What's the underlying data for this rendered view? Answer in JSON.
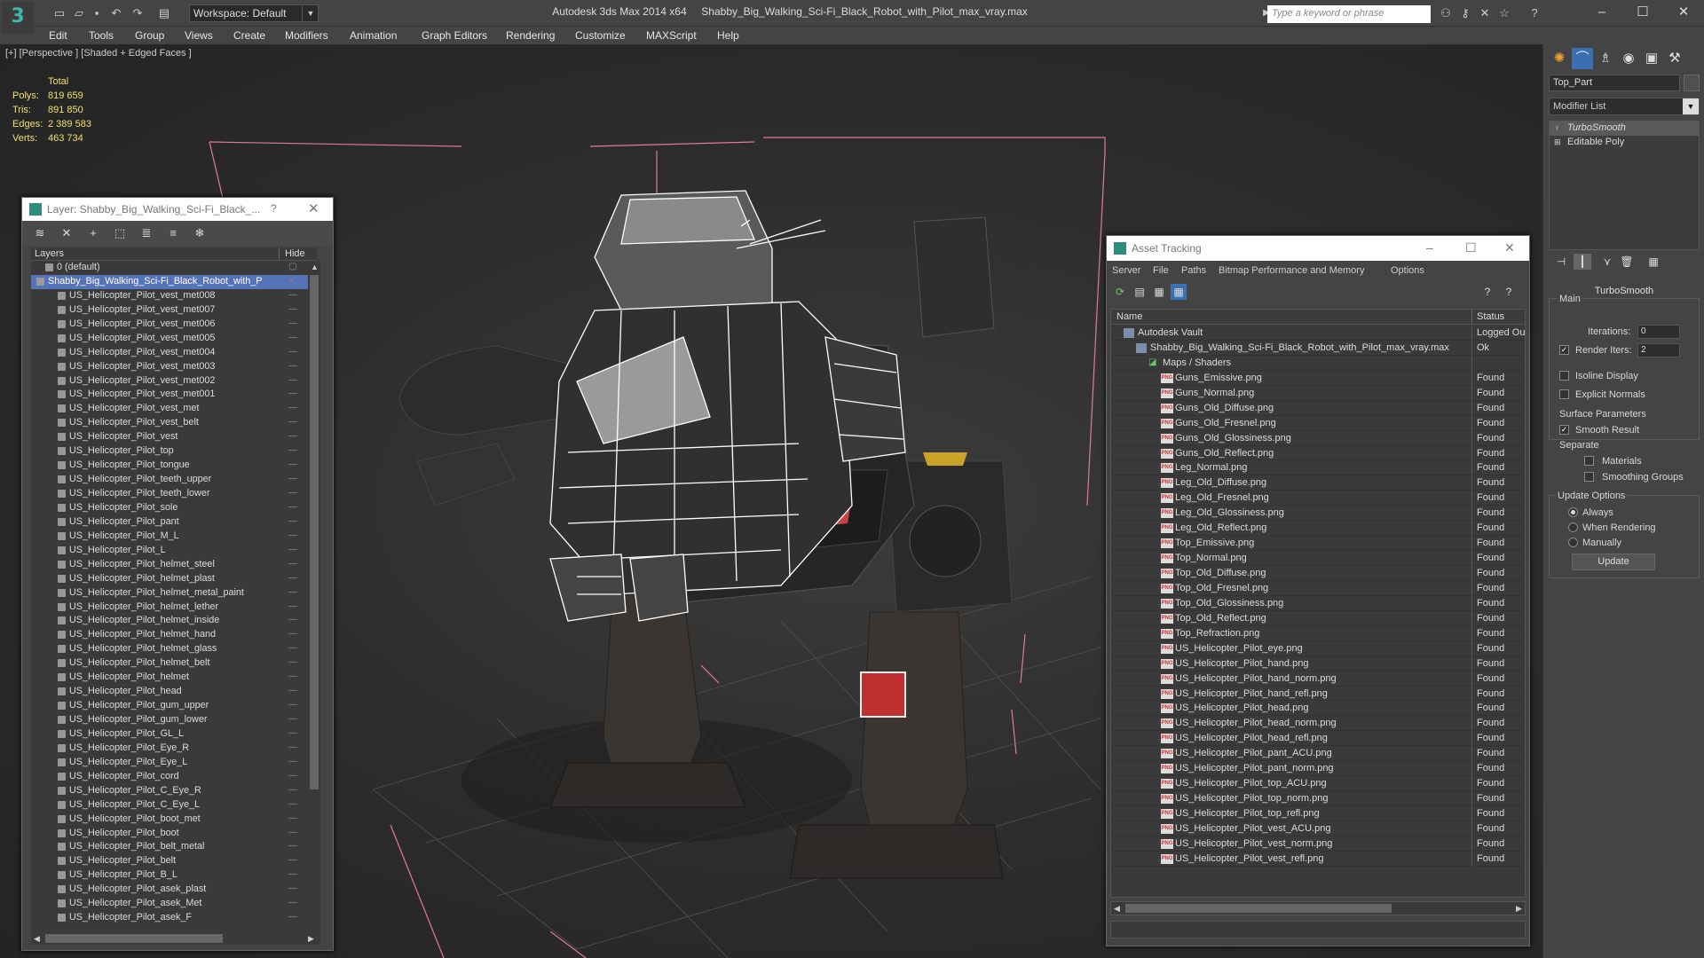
{
  "titlebar": {
    "app": "Autodesk 3ds Max  2014 x64",
    "file": "Shabby_Big_Walking_Sci-Fi_Black_Robot_with_Pilot_max_vray.max",
    "workspace": "Workspace: Default",
    "search_placeholder": "Type a keyword or phrase"
  },
  "menu": [
    "Edit",
    "Tools",
    "Group",
    "Views",
    "Create",
    "Modifiers",
    "Animation",
    "Graph Editors",
    "Rendering",
    "Customize",
    "MAXScript",
    "Help"
  ],
  "viewport": {
    "label": "[+] [Perspective ] [Shaded + Edged Faces ]",
    "stats_header": "Total",
    "stats": [
      {
        "key": "Polys:",
        "value": "819 659"
      },
      {
        "key": "Tris:",
        "value": "891 850"
      },
      {
        "key": "Edges:",
        "value": "2 389 583"
      },
      {
        "key": "Verts:",
        "value": "463 734"
      }
    ]
  },
  "layer_dialog": {
    "title": "Layer: Shabby_Big_Walking_Sci-Fi_Black_...",
    "help": "?",
    "col_layers": "Layers",
    "col_hide": "Hide",
    "rows": [
      {
        "name": "0 (default)",
        "level": 1
      },
      {
        "name": "Shabby_Big_Walking_Sci-Fi_Black_Robot_with_P",
        "level": 0,
        "selected": true
      },
      {
        "name": "US_Helicopter_Pilot_vest_met008",
        "level": 2
      },
      {
        "name": "US_Helicopter_Pilot_vest_met007",
        "level": 2
      },
      {
        "name": "US_Helicopter_Pilot_vest_met006",
        "level": 2
      },
      {
        "name": "US_Helicopter_Pilot_vest_met005",
        "level": 2
      },
      {
        "name": "US_Helicopter_Pilot_vest_met004",
        "level": 2
      },
      {
        "name": "US_Helicopter_Pilot_vest_met003",
        "level": 2
      },
      {
        "name": "US_Helicopter_Pilot_vest_met002",
        "level": 2
      },
      {
        "name": "US_Helicopter_Pilot_vest_met001",
        "level": 2
      },
      {
        "name": "US_Helicopter_Pilot_vest_met",
        "level": 2
      },
      {
        "name": "US_Helicopter_Pilot_vest_belt",
        "level": 2
      },
      {
        "name": "US_Helicopter_Pilot_vest",
        "level": 2
      },
      {
        "name": "US_Helicopter_Pilot_top",
        "level": 2
      },
      {
        "name": "US_Helicopter_Pilot_tongue",
        "level": 2
      },
      {
        "name": "US_Helicopter_Pilot_teeth_upper",
        "level": 2
      },
      {
        "name": "US_Helicopter_Pilot_teeth_lower",
        "level": 2
      },
      {
        "name": "US_Helicopter_Pilot_sole",
        "level": 2
      },
      {
        "name": "US_Helicopter_Pilot_pant",
        "level": 2
      },
      {
        "name": "US_Helicopter_Pilot_M_L",
        "level": 2
      },
      {
        "name": "US_Helicopter_Pilot_L",
        "level": 2
      },
      {
        "name": "US_Helicopter_Pilot_helmet_steel",
        "level": 2
      },
      {
        "name": "US_Helicopter_Pilot_helmet_plast",
        "level": 2
      },
      {
        "name": "US_Helicopter_Pilot_helmet_metal_paint",
        "level": 2
      },
      {
        "name": "US_Helicopter_Pilot_helmet_lether",
        "level": 2
      },
      {
        "name": "US_Helicopter_Pilot_helmet_inside",
        "level": 2
      },
      {
        "name": "US_Helicopter_Pilot_helmet_hand",
        "level": 2
      },
      {
        "name": "US_Helicopter_Pilot_helmet_glass",
        "level": 2
      },
      {
        "name": "US_Helicopter_Pilot_helmet_belt",
        "level": 2
      },
      {
        "name": "US_Helicopter_Pilot_helmet",
        "level": 2
      },
      {
        "name": "US_Helicopter_Pilot_head",
        "level": 2
      },
      {
        "name": "US_Helicopter_Pilot_gum_upper",
        "level": 2
      },
      {
        "name": "US_Helicopter_Pilot_gum_lower",
        "level": 2
      },
      {
        "name": "US_Helicopter_Pilot_GL_L",
        "level": 2
      },
      {
        "name": "US_Helicopter_Pilot_Eye_R",
        "level": 2
      },
      {
        "name": "US_Helicopter_Pilot_Eye_L",
        "level": 2
      },
      {
        "name": "US_Helicopter_Pilot_cord",
        "level": 2
      },
      {
        "name": "US_Helicopter_Pilot_C_Eye_R",
        "level": 2
      },
      {
        "name": "US_Helicopter_Pilot_C_Eye_L",
        "level": 2
      },
      {
        "name": "US_Helicopter_Pilot_boot_met",
        "level": 2
      },
      {
        "name": "US_Helicopter_Pilot_boot",
        "level": 2
      },
      {
        "name": "US_Helicopter_Pilot_belt_metal",
        "level": 2
      },
      {
        "name": "US_Helicopter_Pilot_belt",
        "level": 2
      },
      {
        "name": "US_Helicopter_Pilot_B_L",
        "level": 2
      },
      {
        "name": "US_Helicopter_Pilot_asek_plast",
        "level": 2
      },
      {
        "name": "US_Helicopter_Pilot_asek_Met",
        "level": 2
      },
      {
        "name": "US_Helicopter_Pilot_asek_F",
        "level": 2
      }
    ]
  },
  "asset_dialog": {
    "title": "Asset Tracking",
    "menu": [
      "Server",
      "File",
      "Paths",
      "Bitmap Performance and Memory",
      "Options"
    ],
    "col_name": "Name",
    "col_status": "Status",
    "rows": [
      {
        "name": "Autodesk Vault",
        "status": "Logged Ou",
        "type": "vault",
        "level": 0
      },
      {
        "name": "Shabby_Big_Walking_Sci-Fi_Black_Robot_with_Pilot_max_vray.max",
        "status": "Ok",
        "type": "max",
        "level": 1
      },
      {
        "name": "Maps / Shaders",
        "status": "",
        "type": "maps",
        "level": 2
      },
      {
        "name": "Guns_Emissive.png",
        "status": "Found",
        "type": "png",
        "level": 3
      },
      {
        "name": "Guns_Normal.png",
        "status": "Found",
        "type": "png",
        "level": 3
      },
      {
        "name": "Guns_Old_Diffuse.png",
        "status": "Found",
        "type": "png",
        "level": 3
      },
      {
        "name": "Guns_Old_Fresnel.png",
        "status": "Found",
        "type": "png",
        "level": 3
      },
      {
        "name": "Guns_Old_Glossiness.png",
        "status": "Found",
        "type": "png",
        "level": 3
      },
      {
        "name": "Guns_Old_Reflect.png",
        "status": "Found",
        "type": "png",
        "level": 3
      },
      {
        "name": "Leg_Normal.png",
        "status": "Found",
        "type": "png",
        "level": 3
      },
      {
        "name": "Leg_Old_Diffuse.png",
        "status": "Found",
        "type": "png",
        "level": 3
      },
      {
        "name": "Leg_Old_Fresnel.png",
        "status": "Found",
        "type": "png",
        "level": 3
      },
      {
        "name": "Leg_Old_Glossiness.png",
        "status": "Found",
        "type": "png",
        "level": 3
      },
      {
        "name": "Leg_Old_Reflect.png",
        "status": "Found",
        "type": "png",
        "level": 3
      },
      {
        "name": "Top_Emissive.png",
        "status": "Found",
        "type": "png",
        "level": 3
      },
      {
        "name": "Top_Normal.png",
        "status": "Found",
        "type": "png",
        "level": 3
      },
      {
        "name": "Top_Old_Diffuse.png",
        "status": "Found",
        "type": "png",
        "level": 3
      },
      {
        "name": "Top_Old_Fresnel.png",
        "status": "Found",
        "type": "png",
        "level": 3
      },
      {
        "name": "Top_Old_Glossiness.png",
        "status": "Found",
        "type": "png",
        "level": 3
      },
      {
        "name": "Top_Old_Reflect.png",
        "status": "Found",
        "type": "png",
        "level": 3
      },
      {
        "name": "Top_Refraction.png",
        "status": "Found",
        "type": "png",
        "level": 3
      },
      {
        "name": "US_Helicopter_Pilot_eye.png",
        "status": "Found",
        "type": "png",
        "level": 3
      },
      {
        "name": "US_Helicopter_Pilot_hand.png",
        "status": "Found",
        "type": "png",
        "level": 3
      },
      {
        "name": "US_Helicopter_Pilot_hand_norm.png",
        "status": "Found",
        "type": "png",
        "level": 3
      },
      {
        "name": "US_Helicopter_Pilot_hand_refl.png",
        "status": "Found",
        "type": "png",
        "level": 3
      },
      {
        "name": "US_Helicopter_Pilot_head.png",
        "status": "Found",
        "type": "png",
        "level": 3
      },
      {
        "name": "US_Helicopter_Pilot_head_norm.png",
        "status": "Found",
        "type": "png",
        "level": 3
      },
      {
        "name": "US_Helicopter_Pilot_head_refl.png",
        "status": "Found",
        "type": "png",
        "level": 3
      },
      {
        "name": "US_Helicopter_Pilot_pant_ACU.png",
        "status": "Found",
        "type": "png",
        "level": 3
      },
      {
        "name": "US_Helicopter_Pilot_pant_norm.png",
        "status": "Found",
        "type": "png",
        "level": 3
      },
      {
        "name": "US_Helicopter_Pilot_top_ACU.png",
        "status": "Found",
        "type": "png",
        "level": 3
      },
      {
        "name": "US_Helicopter_Pilot_top_norm.png",
        "status": "Found",
        "type": "png",
        "level": 3
      },
      {
        "name": "US_Helicopter_Pilot_top_refl.png",
        "status": "Found",
        "type": "png",
        "level": 3
      },
      {
        "name": "US_Helicopter_Pilot_vest_ACU.png",
        "status": "Found",
        "type": "png",
        "level": 3
      },
      {
        "name": "US_Helicopter_Pilot_vest_norm.png",
        "status": "Found",
        "type": "png",
        "level": 3
      },
      {
        "name": "US_Helicopter_Pilot_vest_refl.png",
        "status": "Found",
        "type": "png",
        "level": 3
      }
    ]
  },
  "command_panel": {
    "object_name": "Top_Part",
    "modifier_list": "Modifier List",
    "stack": [
      "TurboSmooth",
      "Editable Poly"
    ],
    "rollout_title": "TurboSmooth",
    "main_label": "Main",
    "iterations_label": "Iterations:",
    "iterations_value": "0",
    "render_iters_label": "Render Iters:",
    "render_iters_value": "2",
    "isoline_label": "Isoline Display",
    "explicit_label": "Explicit Normals",
    "surface_label": "Surface Parameters",
    "smooth_label": "Smooth Result",
    "separate_label": "Separate",
    "materials_label": "Materials",
    "smoothing_groups_label": "Smoothing Groups",
    "update_options_label": "Update Options",
    "always_label": "Always",
    "when_rendering_label": "When Rendering",
    "manually_label": "Manually",
    "update_button": "Update"
  },
  "colors": {
    "selection": "#5773b8",
    "stats": "#f0e070",
    "bounding_box": "#e07aa0",
    "accent": "#3fb6b0"
  }
}
